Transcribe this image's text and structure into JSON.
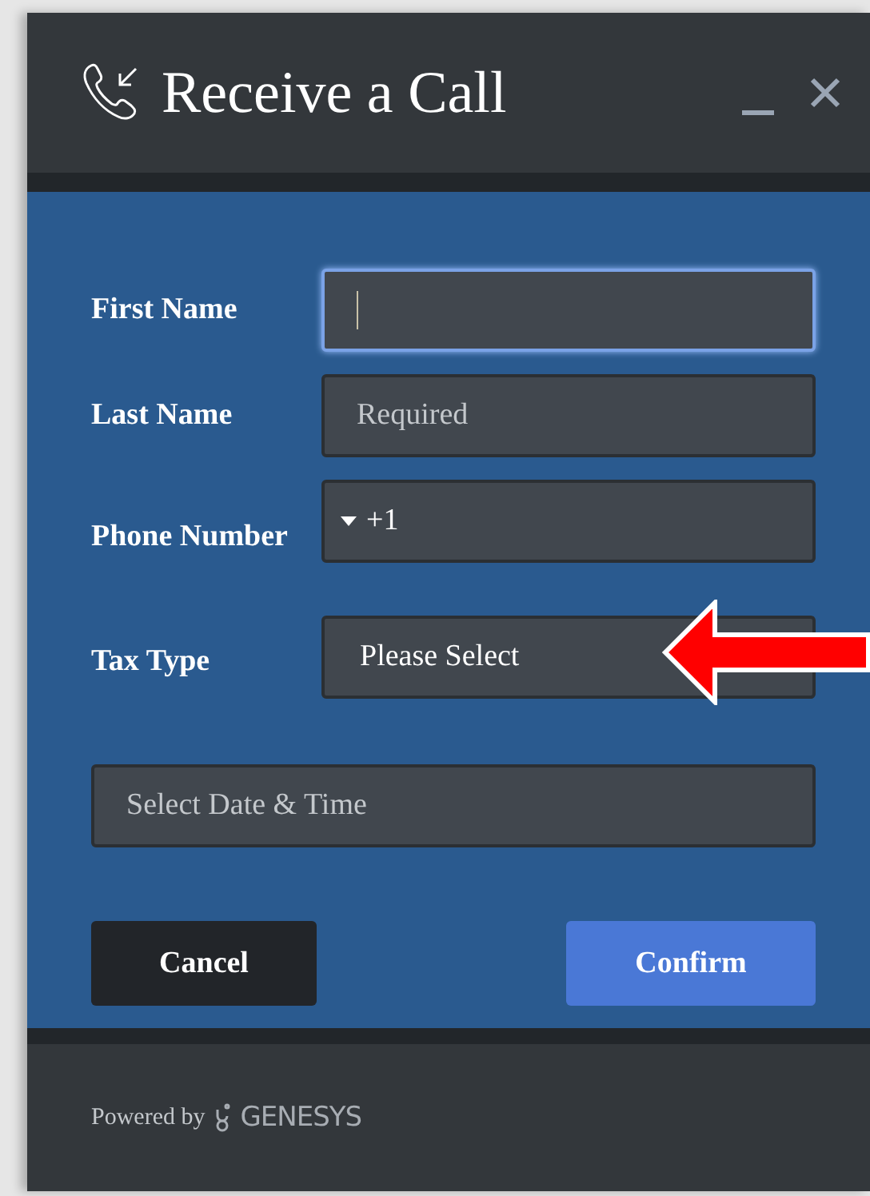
{
  "window": {
    "title": "Receive a Call"
  },
  "fields": [
    {
      "kind": "text",
      "label": "First Name",
      "focused": true
    },
    {
      "kind": "text",
      "label": "Last Name",
      "placeholder": "Required",
      "focused": false
    },
    {
      "kind": "phone",
      "label": "Phone Number",
      "value": "+1",
      "focused": false
    },
    {
      "kind": "select",
      "label": "Tax Type",
      "value": "Please Select",
      "focused": false,
      "annotated": true
    },
    {
      "kind": "wide",
      "placeholder": "Select Date & Time",
      "focused": false
    }
  ],
  "buttons": [
    {
      "label": "Cancel",
      "kind": "secondary"
    },
    {
      "label": "Confirm",
      "kind": "primary"
    }
  ],
  "footer": {
    "powered_by": "Powered by",
    "brand": "GENESYS"
  }
}
